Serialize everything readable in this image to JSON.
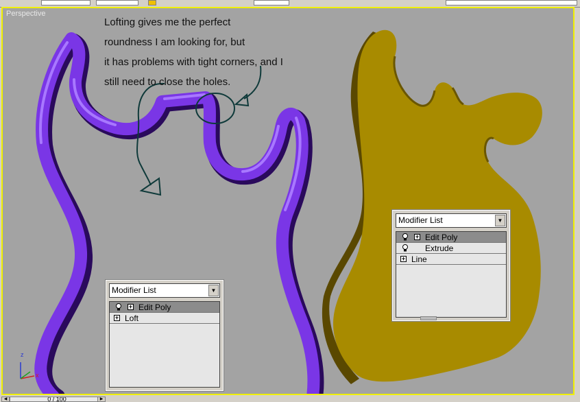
{
  "viewport": {
    "label": "Perspective",
    "border_color": "#f0f000"
  },
  "annotation": {
    "lines": [
      "Lofting gives me the perfect",
      "roundness I am looking for, but",
      "it has problems with tight corners, and I",
      "still need to close the holes."
    ]
  },
  "left_panel": {
    "dropdown_label": "Modifier List",
    "items": [
      {
        "label": "Edit Poly",
        "selected": true
      },
      {
        "label": "Loft",
        "selected": false
      }
    ]
  },
  "right_panel": {
    "dropdown_label": "Modifier List",
    "items": [
      {
        "label": "Edit Poly",
        "selected": true
      },
      {
        "label": "Extrude",
        "selected": false
      },
      {
        "label": "Line",
        "selected": false
      }
    ]
  },
  "axis": {
    "z": "z",
    "x": "x"
  },
  "timeline": {
    "value": "0 / 100"
  },
  "colors": {
    "loft_purple": "#7a36e6",
    "extrude_gold": "#a88b00"
  }
}
